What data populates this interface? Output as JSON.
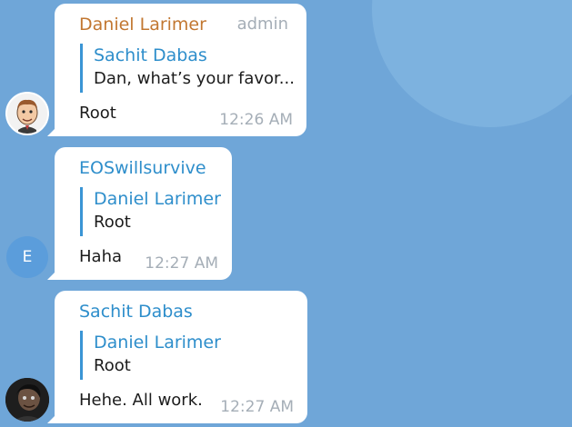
{
  "messages": [
    {
      "sender": "Daniel Larimer",
      "role": "admin",
      "quote_author": "Sachit Dabas",
      "quote_text": "Dan, what’s your favor...",
      "text": "Root",
      "time": "12:26 AM"
    },
    {
      "sender": "EOSwillsurvive",
      "avatar_letter": "E",
      "quote_author": "Daniel Larimer",
      "quote_text": "Root",
      "text": "Haha",
      "time": "12:27 AM"
    },
    {
      "sender": "Sachit Dabas",
      "quote_author": "Daniel Larimer",
      "quote_text": "Root",
      "text": "Hehe. All work.",
      "time": "12:27 AM"
    }
  ],
  "colors": {
    "background": "#6fa6d8",
    "admin_name": "#c27731",
    "name_blue": "#2e8ecb",
    "quote_bar": "#3a95d5",
    "meta_gray": "#a5aeb7"
  }
}
